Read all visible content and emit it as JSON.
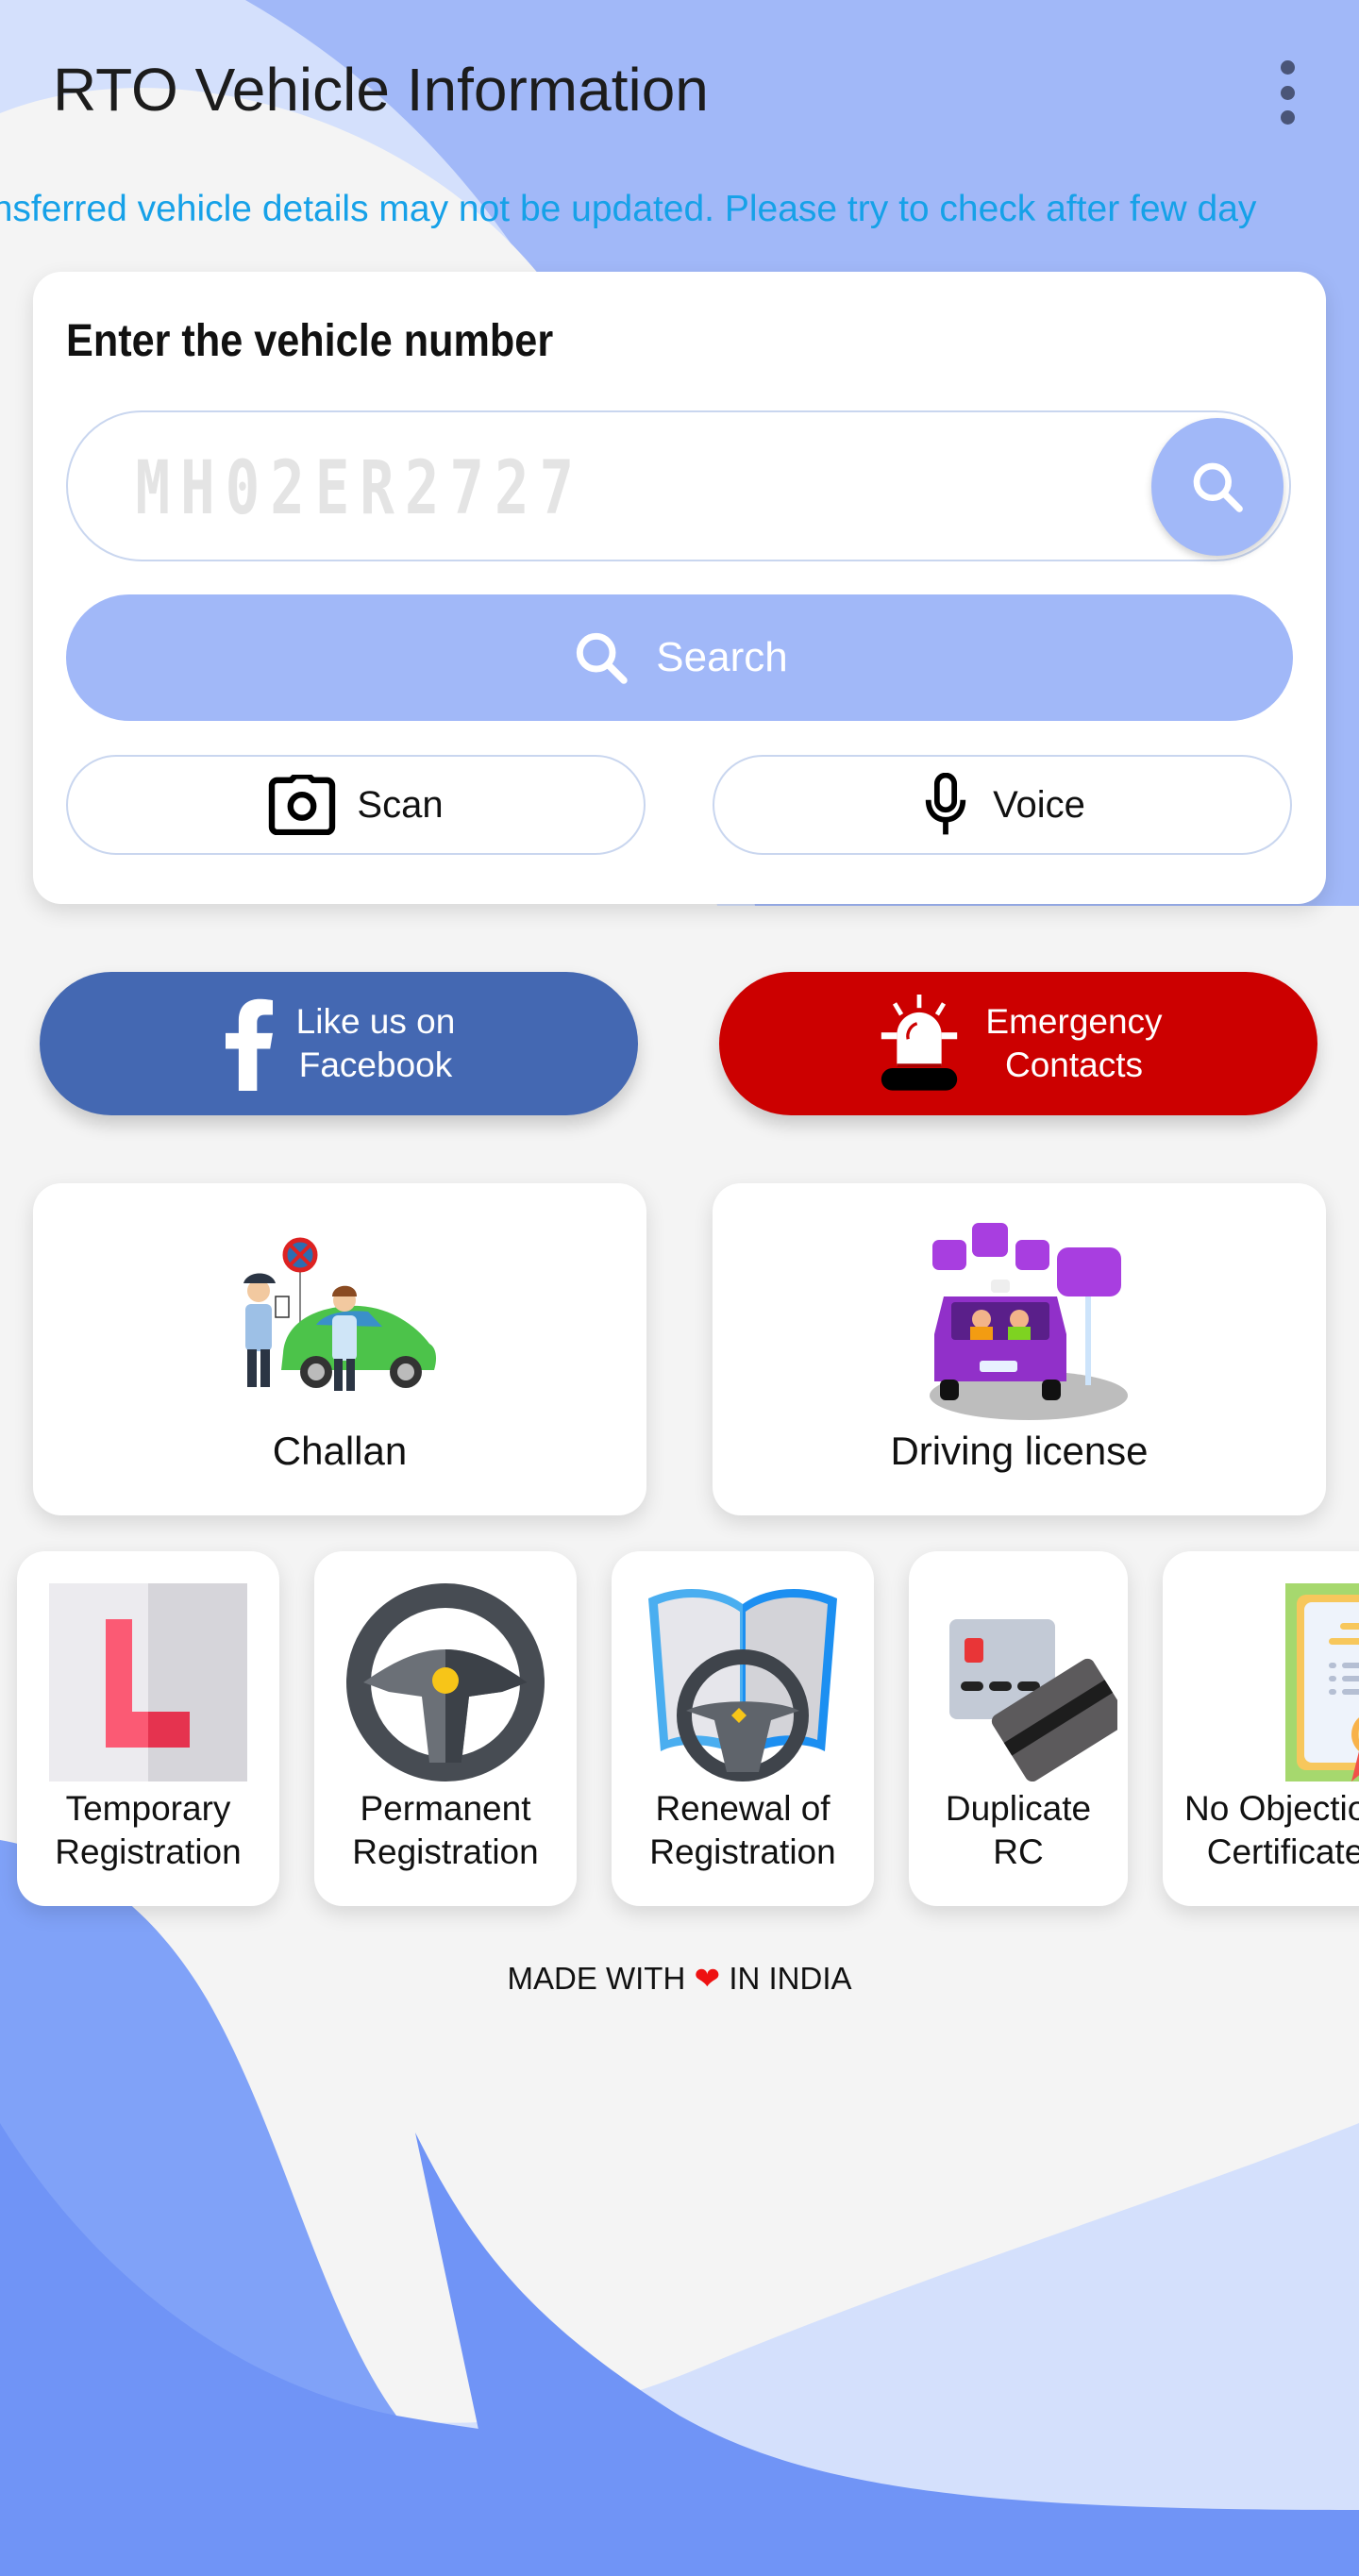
{
  "app": {
    "title": "RTO Vehicle Information",
    "menu_icon": "more-vert-icon"
  },
  "notice": {
    "text": "Transferred vehicle details may not be updated. Please try to check after few days",
    "visible_text": "ansferred vehicle details may not be updated. Please try to check after few day",
    "color": "#16a1e8"
  },
  "search_card": {
    "heading": "Enter the vehicle number",
    "vehicle_input": {
      "value": "",
      "placeholder": "MH02ER2727"
    },
    "round_search_icon": "search-icon",
    "search_button": {
      "label": "Search",
      "icon": "search-icon"
    },
    "scan_button": {
      "label": "Scan",
      "icon": "camera-icon"
    },
    "voice_button": {
      "label": "Voice",
      "icon": "microphone-icon"
    }
  },
  "social": {
    "facebook": {
      "line1": "Like us on",
      "line2": "Facebook",
      "icon": "facebook-icon",
      "color": "#4468b2"
    },
    "emergency": {
      "line1": "Emergency",
      "line2": "Contacts",
      "icon": "siren-icon",
      "color": "#cc0000"
    }
  },
  "features": [
    {
      "label": "Challan",
      "icon": "traffic-police-illustration"
    },
    {
      "label": "Driving license",
      "icon": "learner-car-illustration"
    }
  ],
  "services": [
    {
      "label": "Temporary\nRegistration",
      "icon": "learner-l-plate-icon"
    },
    {
      "label": "Permanent\nRegistration",
      "icon": "steering-wheel-icon"
    },
    {
      "label": "Renewal of\nRegistration",
      "icon": "book-steering-wheel-icon"
    },
    {
      "label": "Duplicate\nRC",
      "icon": "cards-icon"
    },
    {
      "label": "No Objection\nCertificate",
      "icon": "certificate-icon"
    }
  ],
  "footer": {
    "prefix": "MADE WITH",
    "heart": "❤",
    "suffix": "IN INDIA"
  },
  "colors": {
    "accent": "#a1b8f8",
    "background": "#f4f4f4",
    "wave_dark": "#7094f6",
    "wave_mid": "#80a2f8",
    "wave_light": "#d4e0fc"
  }
}
